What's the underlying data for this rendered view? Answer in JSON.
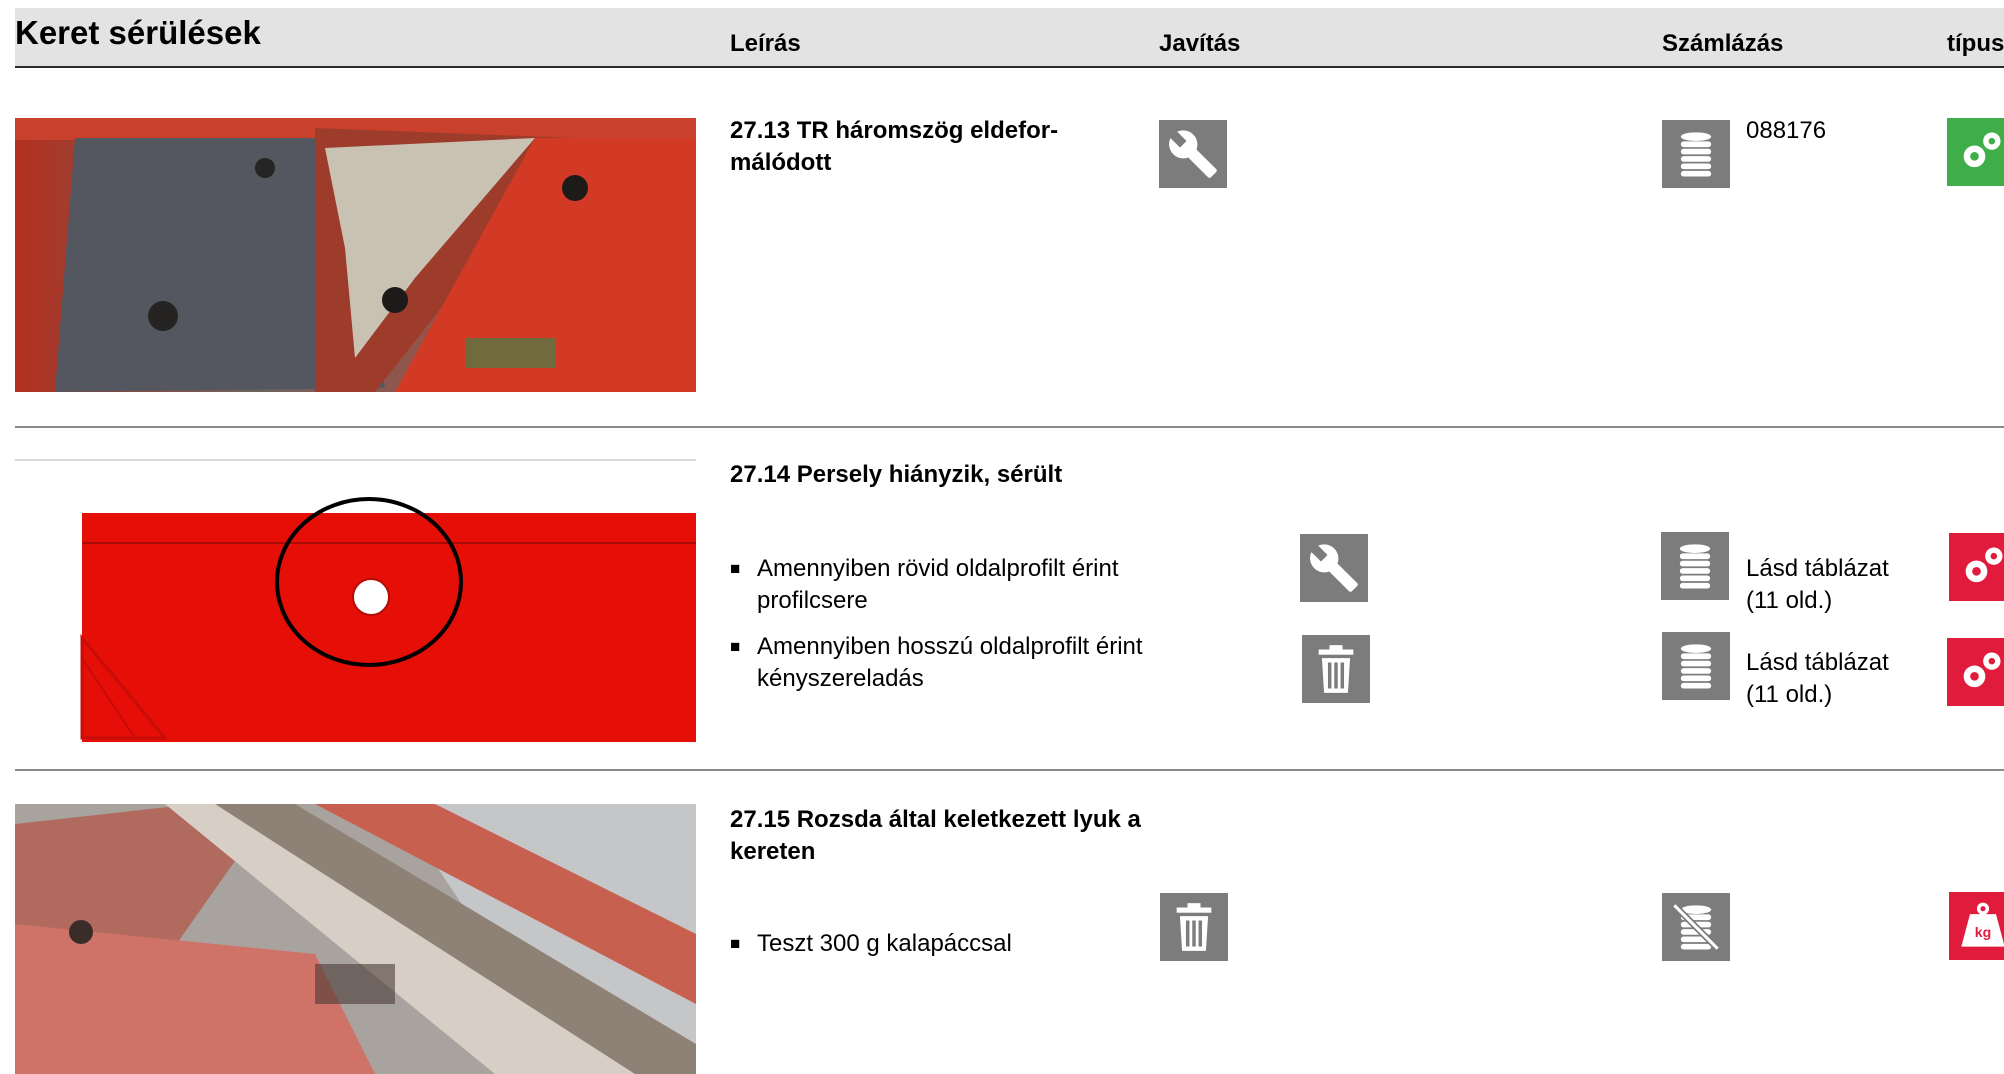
{
  "header": {
    "title": "Keret sérülések",
    "col_description": "Leírás",
    "col_repair": "Javítás",
    "col_billing": "Számlázás",
    "col_type": "típus"
  },
  "rows": [
    {
      "title": "27.13 TR háromszög eldefor-\nmálódott",
      "billing_text": "088176"
    },
    {
      "title": "27.14 Persely hiányzik, sérült",
      "bullets": [
        {
          "text": "Amennyiben rövid oldalprofilt érint profilcsere",
          "billing_text": "Lásd táblázat\n(11 old.)"
        },
        {
          "text": "Amennyiben hosszú oldalprofilt érint kényszereladás",
          "billing_text": "Lásd táblázat\n(11 old.)"
        }
      ]
    },
    {
      "title": "27.15 Rozsda által keletkezett lyuk a kereten",
      "bullets": [
        {
          "text": "Teszt 300 g kalapáccsal"
        }
      ]
    }
  ],
  "icons": {
    "repair": "wrench-icon",
    "scrap": "trash-icon",
    "billing": "coin-stack-icon",
    "no_billing": "coin-stack-crossed-icon",
    "type_process": "gears-icon",
    "type_weight": "weight-kg-icon",
    "weight_label": "kg"
  },
  "colors": {
    "header_bg": "#e3e3e3",
    "icon_gray": "#7c7c7c",
    "type_green": "#3fae49",
    "type_red": "#e11b3c"
  }
}
